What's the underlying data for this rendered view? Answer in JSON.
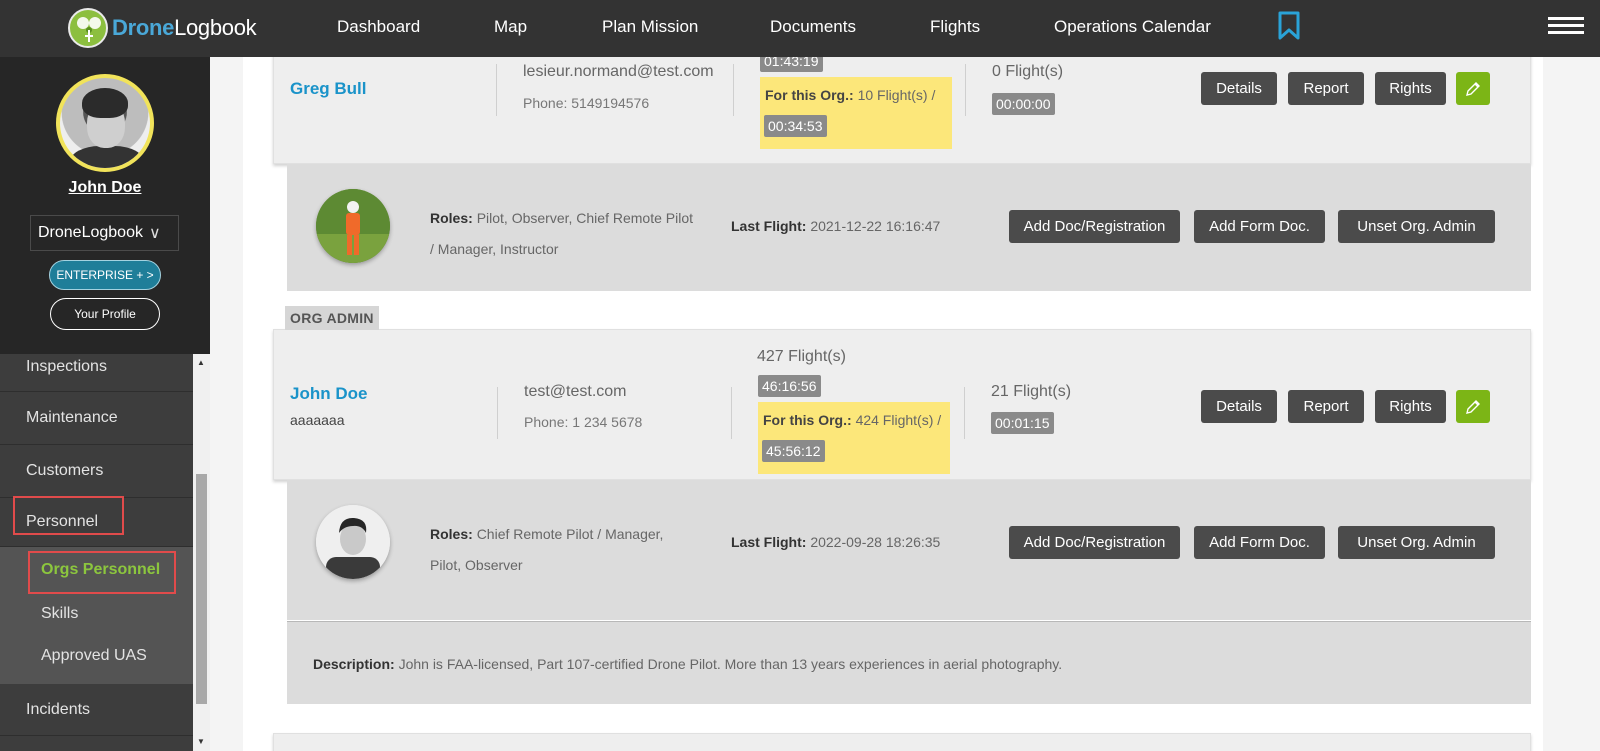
{
  "app": {
    "logo_part1": "Drone",
    "logo_part2": "Logbook"
  },
  "nav": {
    "dashboard": "Dashboard",
    "map": "Map",
    "plan_mission": "Plan Mission",
    "documents": "Documents",
    "flights": "Flights",
    "operations_calendar": "Operations Calendar"
  },
  "profile": {
    "name": "John Doe",
    "org_select": "DroneLogbook",
    "enterprise_label": "ENTERPRISE + >",
    "your_profile_label": "Your Profile"
  },
  "menu": {
    "inspections": "Inspections",
    "maintenance": "Maintenance",
    "customers": "Customers",
    "personnel": "Personnel",
    "orgs_personnel": "Orgs Personnel",
    "skills": "Skills",
    "approved_uas": "Approved UAS",
    "incidents": "Incidents"
  },
  "buttons": {
    "details": "Details",
    "report": "Report",
    "rights": "Rights",
    "add_doc": "Add Doc/Registration",
    "add_form": "Add Form Doc.",
    "unset_admin": "Unset Org. Admin"
  },
  "labels": {
    "for_org": "For this Org.:",
    "roles": "Roles:",
    "last_flight": "Last Flight:",
    "description": "Description:",
    "org_admin": "ORG ADMIN"
  },
  "persons": [
    {
      "name": "Greg Bull",
      "email": "lesieur.normand@test.com",
      "phone": "Phone: 5149194576",
      "total_time": "01:43:19",
      "org_flights": "10 Flight(s) /",
      "org_time": "00:34:53",
      "other_flights": "0 Flight(s)",
      "other_time": "00:00:00",
      "roles_line1": "Pilot, Observer, Chief Remote Pilot",
      "roles_line2": "/ Manager, Instructor",
      "last_flight": "2021-12-22 16:16:47"
    },
    {
      "name": "John Doe",
      "subtitle": "aaaaaaa",
      "email": "test@test.com",
      "phone": "Phone: 1 234 5678",
      "total_flights": "427 Flight(s)",
      "total_time": "46:16:56",
      "org_flights": "424 Flight(s) /",
      "org_time": "45:56:12",
      "other_flights": "21 Flight(s)",
      "other_time": "00:01:15",
      "roles_line1": "Chief Remote Pilot / Manager,",
      "roles_line2": "Pilot, Observer",
      "last_flight": "2022-09-28 18:26:35",
      "description": "John is FAA-licensed, Part 107-certified Drone Pilot. More than 13 years experiences in aerial photography."
    }
  ],
  "colors": {
    "topbar": "#333333",
    "accent_blue": "#1a93c9",
    "accent_green": "#8cc63e",
    "highlight_yellow": "#fce77a",
    "highlight_box": "#e14b4b"
  }
}
